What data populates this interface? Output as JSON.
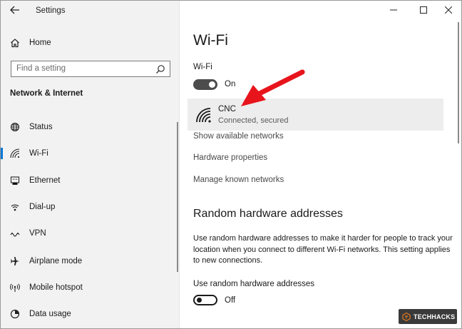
{
  "window": {
    "title": "Settings",
    "controls": {
      "minimize": "—",
      "maximize": "☐",
      "close": "✕"
    }
  },
  "sidebar": {
    "home_label": "Home",
    "search_placeholder": "Find a setting",
    "section_title": "Network & Internet",
    "items": [
      {
        "label": "Status",
        "icon": "globe-icon"
      },
      {
        "label": "Wi-Fi",
        "icon": "wifi-icon",
        "active": true
      },
      {
        "label": "Ethernet",
        "icon": "ethernet-icon"
      },
      {
        "label": "Dial-up",
        "icon": "dialup-icon"
      },
      {
        "label": "VPN",
        "icon": "vpn-icon"
      },
      {
        "label": "Airplane mode",
        "icon": "airplane-icon"
      },
      {
        "label": "Mobile hotspot",
        "icon": "hotspot-icon"
      },
      {
        "label": "Data usage",
        "icon": "data-usage-icon"
      }
    ]
  },
  "main": {
    "page_title": "Wi-Fi",
    "wifi_label": "Wi-Fi",
    "wifi_toggle": {
      "state": "On",
      "on": true
    },
    "network": {
      "name": "CNC",
      "status": "Connected, secured"
    },
    "links": [
      "Show available networks",
      "Hardware properties",
      "Manage known networks"
    ],
    "random_hw": {
      "title": "Random hardware addresses",
      "description": "Use random hardware addresses to make it harder for people to track your location when you connect to different Wi-Fi networks. This setting applies to new connections.",
      "label": "Use random hardware addresses",
      "toggle": {
        "state": "Off",
        "on": false
      }
    }
  },
  "watermark": {
    "text": "TECHHACKS"
  },
  "colors": {
    "accent": "#0078d7",
    "arrow": "#e8141b",
    "toggle_on": "#4c4c4c"
  }
}
